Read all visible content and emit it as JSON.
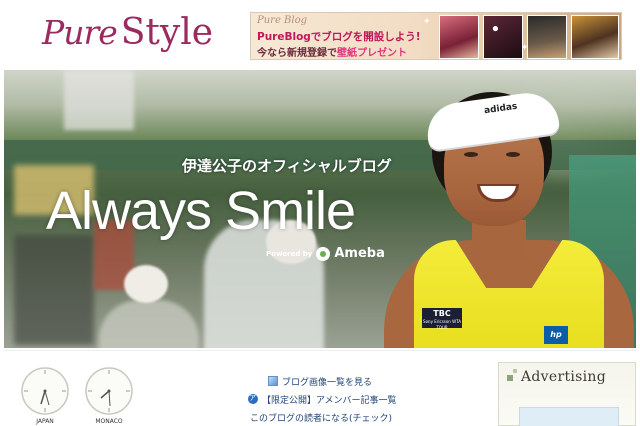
{
  "header": {
    "logo_pure": "Pure",
    "logo_style": "Style"
  },
  "banner": {
    "small_text": "Pure Blog",
    "line1": "PureBlogでブログを開設しよう!",
    "line2_prefix": "今なら新規登録で",
    "line2_highlight": "壁紙プレゼント"
  },
  "hero": {
    "subtitle": "伊達公子のオフィシャルブログ",
    "title": "Always Smile",
    "powered_by": "Powered by",
    "powered_brand": "Ameba",
    "shirt_logo": "TBC",
    "shirt_logo_small": "Sony Ericsson WTA TOUR",
    "shirt_hp": "hp",
    "visor_logo": "adidas"
  },
  "clocks": [
    {
      "label": "JAPAN"
    },
    {
      "label": "MONACO"
    }
  ],
  "links": [
    {
      "icon": "image-list-icon",
      "label": "ブログ画像一覧を見る"
    },
    {
      "icon": "ameba-icon",
      "label": "【限定公開】アメンバー記事一覧"
    },
    {
      "icon": "",
      "label": "このブログの読者になる(チェック)"
    }
  ],
  "sidebar": {
    "advertising_title": "Advertising"
  },
  "colors": {
    "brand": "#9b2a5f",
    "link": "#224477",
    "hero_text": "#ffffff"
  }
}
